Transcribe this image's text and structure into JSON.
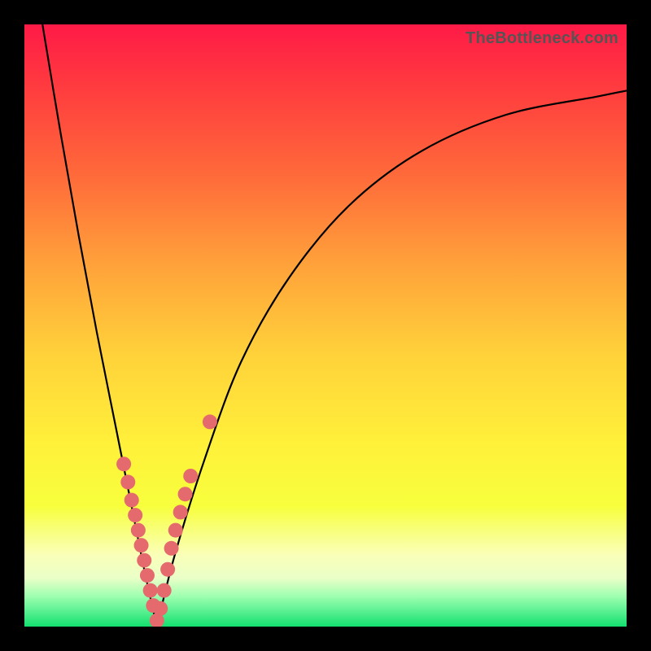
{
  "watermark": "TheBottleneck.com",
  "chart_data": {
    "type": "line",
    "title": "",
    "xlabel": "",
    "ylabel": "",
    "xlim": [
      0,
      100
    ],
    "ylim": [
      0,
      100
    ],
    "notch_x": 22,
    "left_curve": {
      "x": [
        3,
        6,
        9,
        12,
        15,
        18,
        20,
        22
      ],
      "y": [
        100,
        82,
        65,
        49,
        34,
        19,
        9,
        0
      ]
    },
    "right_curve": {
      "x": [
        22,
        25,
        30,
        36,
        44,
        54,
        66,
        80,
        95,
        100
      ],
      "y": [
        0,
        12,
        28,
        44,
        58,
        70,
        79,
        85,
        88,
        89
      ]
    },
    "markers": {
      "x": [
        16.5,
        17.2,
        17.8,
        18.4,
        18.9,
        19.4,
        19.9,
        20.4,
        20.9,
        21.4,
        22.0,
        22.6,
        23.2,
        23.8,
        24.4,
        25.1,
        25.9,
        26.7,
        27.6,
        30.8
      ],
      "y": [
        27,
        24,
        21,
        18.5,
        16,
        13.5,
        11,
        8.5,
        6,
        3.5,
        1,
        3,
        6,
        9.5,
        13,
        16,
        19,
        22,
        25,
        34
      ],
      "color": "#e46a6e",
      "radius": 9
    },
    "gradient_stops": [
      {
        "pos": 0.0,
        "color": "#ff1a47"
      },
      {
        "pos": 0.1,
        "color": "#ff3a3f"
      },
      {
        "pos": 0.25,
        "color": "#ff6a3a"
      },
      {
        "pos": 0.4,
        "color": "#ffa23a"
      },
      {
        "pos": 0.55,
        "color": "#ffd23a"
      },
      {
        "pos": 0.7,
        "color": "#fff13a"
      },
      {
        "pos": 0.8,
        "color": "#f7ff3d"
      },
      {
        "pos": 0.88,
        "color": "#faffb8"
      },
      {
        "pos": 0.92,
        "color": "#e9ffc8"
      },
      {
        "pos": 0.95,
        "color": "#9dffb0"
      },
      {
        "pos": 1.0,
        "color": "#13e070"
      }
    ]
  }
}
